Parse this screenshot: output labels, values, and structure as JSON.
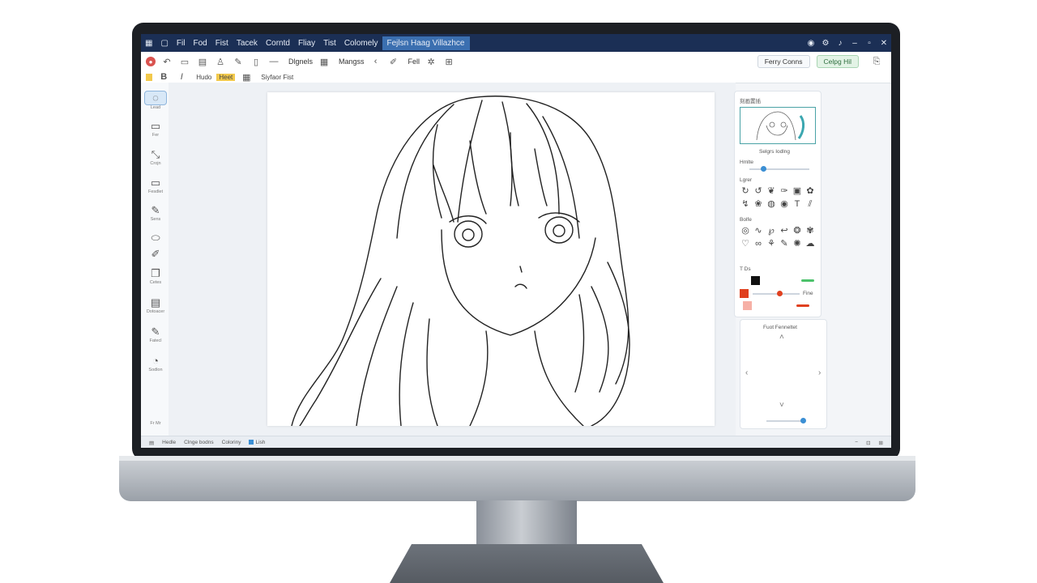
{
  "titlebar": {
    "menus": [
      "Fil",
      "Fod",
      "Fist",
      "Tacek",
      "Corntd",
      "Fliay",
      "Tist",
      "Colomely"
    ],
    "active_tab": "Fejlsn Haag Villazhce"
  },
  "toolbar": {
    "item_a": "Dlgnels",
    "item_b": "Mangss",
    "item_c": "Fell",
    "preview_button": "Ferry Conns",
    "share_button": "Celpg Hil"
  },
  "toolbar2": {
    "item_a": "Hudo",
    "highlight": "Heet",
    "item_b": "Siyfaor Fist"
  },
  "tools": [
    "Lead",
    "Fer",
    "Crojn",
    "Fesdlet",
    "Sens",
    "Cetes",
    "Dotoacer",
    "Fatecl",
    "Sodlon"
  ],
  "rail_footer": "Fr Mr",
  "panel": {
    "header": "刻画置插",
    "section_title": "Selgrs Iodlng",
    "label_a": "Hmlte",
    "label_b": "Lgrer",
    "label_c": "Bolfe",
    "label_d": "T Ds",
    "value_a": "Fine"
  },
  "panel2": {
    "header": "Fuot Fenneltet"
  },
  "statusbar": {
    "item_a": "Hedle",
    "item_b": "Clnge bodns",
    "item_c": "Coloriny",
    "item_d": "Lish"
  }
}
